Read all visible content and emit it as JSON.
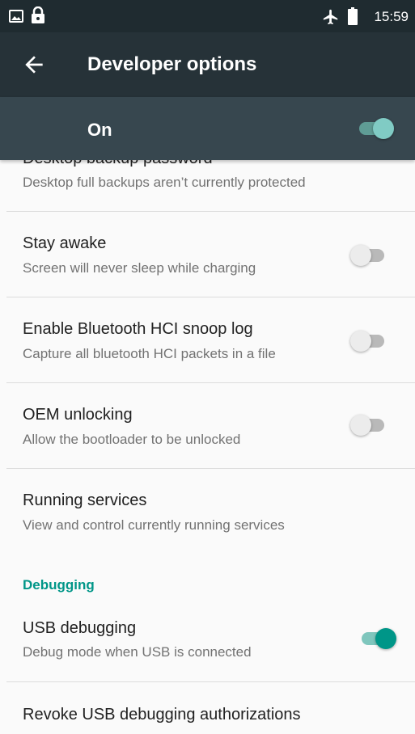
{
  "status_bar": {
    "time": "15:59",
    "left_icons": [
      "image-icon",
      "lock-icon"
    ],
    "right_icons": [
      "airplane-icon",
      "battery-icon"
    ]
  },
  "toolbar": {
    "back_icon": "arrow-left-icon",
    "title": "Developer options"
  },
  "master_switch": {
    "label": "On",
    "checked": true
  },
  "colors": {
    "status_bar_bg": "#1f2b30",
    "toolbar_bg": "#263238",
    "switch_bar_bg": "#37474f",
    "accent": "#009688"
  },
  "settings": [
    {
      "title": "Desktop backup password",
      "summary": "Desktop full backups aren’t currently protected"
    },
    {
      "title": "Stay awake",
      "summary": "Screen will never sleep while charging",
      "toggle": false
    },
    {
      "title": "Enable Bluetooth HCI snoop log",
      "summary": "Capture all bluetooth HCI packets in a file",
      "toggle": false
    },
    {
      "title": "OEM unlocking",
      "summary": "Allow the bootloader to be unlocked",
      "toggle": false
    },
    {
      "title": "Running services",
      "summary": "View and control currently running services"
    }
  ],
  "debugging_section": {
    "header": "Debugging",
    "items": [
      {
        "title": "USB debugging",
        "summary": "Debug mode when USB is connected",
        "toggle": true
      },
      {
        "title": "Revoke USB debugging authorizations"
      }
    ]
  }
}
